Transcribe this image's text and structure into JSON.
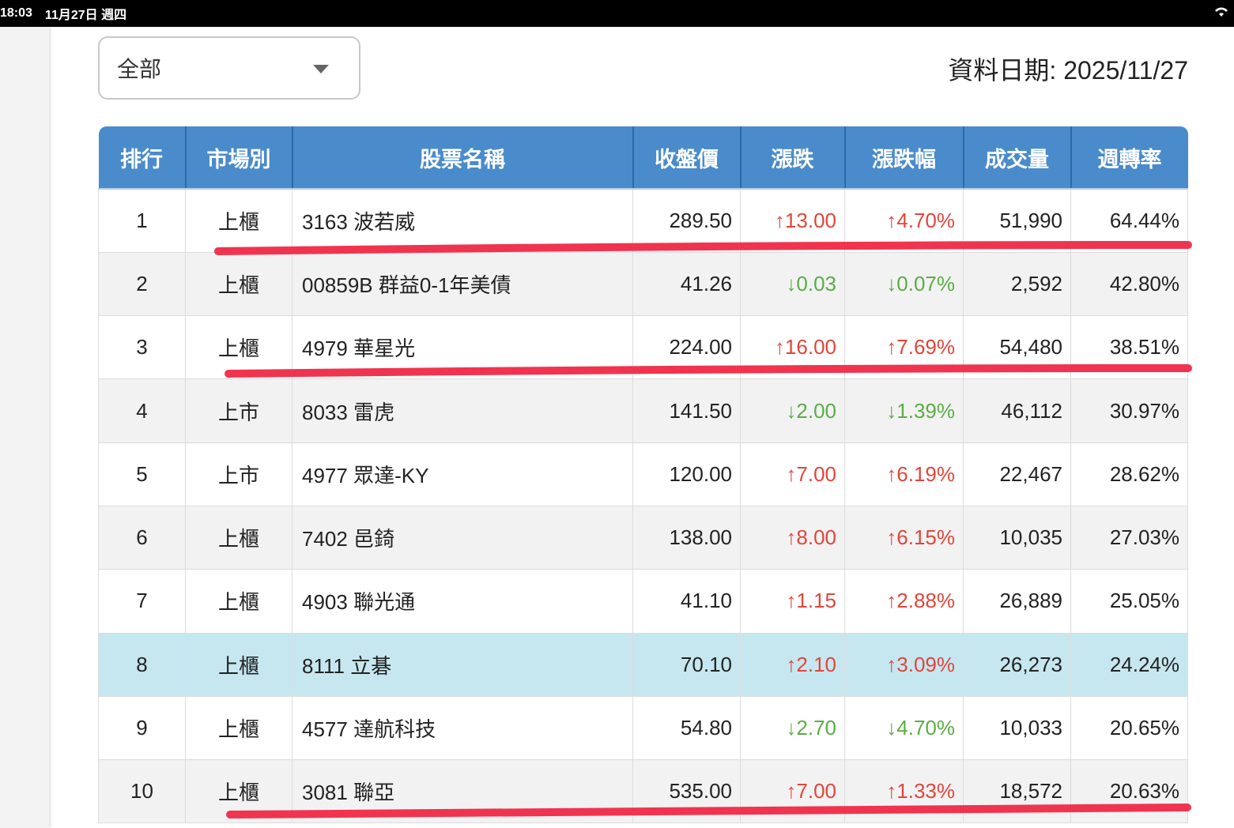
{
  "status_bar": {
    "time": "18:03",
    "date": "11月27日 週四"
  },
  "filter": {
    "selected": "全部"
  },
  "data_date": "資料日期: 2025/11/27",
  "columns": [
    "排行",
    "市場別",
    "股票名稱",
    "收盤價",
    "漲跌",
    "漲跌幅",
    "成交量",
    "週轉率"
  ],
  "rows": [
    {
      "rank": "1",
      "market": "上櫃",
      "name": "3163 波若威",
      "close": "289.50",
      "change": "↑13.00",
      "pct": "↑4.70%",
      "volume": "51,990",
      "turnover": "64.44%",
      "dir": "up"
    },
    {
      "rank": "2",
      "market": "上櫃",
      "name": "00859B 群益0-1年美債",
      "close": "41.26",
      "change": "↓0.03",
      "pct": "↓0.07%",
      "volume": "2,592",
      "turnover": "42.80%",
      "dir": "down"
    },
    {
      "rank": "3",
      "market": "上櫃",
      "name": "4979 華星光",
      "close": "224.00",
      "change": "↑16.00",
      "pct": "↑7.69%",
      "volume": "54,480",
      "turnover": "38.51%",
      "dir": "up"
    },
    {
      "rank": "4",
      "market": "上市",
      "name": "8033 雷虎",
      "close": "141.50",
      "change": "↓2.00",
      "pct": "↓1.39%",
      "volume": "46,112",
      "turnover": "30.97%",
      "dir": "down"
    },
    {
      "rank": "5",
      "market": "上市",
      "name": "4977 眾達-KY",
      "close": "120.00",
      "change": "↑7.00",
      "pct": "↑6.19%",
      "volume": "22,467",
      "turnover": "28.62%",
      "dir": "up"
    },
    {
      "rank": "6",
      "market": "上櫃",
      "name": "7402 邑錡",
      "close": "138.00",
      "change": "↑8.00",
      "pct": "↑6.15%",
      "volume": "10,035",
      "turnover": "27.03%",
      "dir": "up"
    },
    {
      "rank": "7",
      "market": "上櫃",
      "name": "4903 聯光通",
      "close": "41.10",
      "change": "↑1.15",
      "pct": "↑2.88%",
      "volume": "26,889",
      "turnover": "25.05%",
      "dir": "up"
    },
    {
      "rank": "8",
      "market": "上櫃",
      "name": "8111 立碁",
      "close": "70.10",
      "change": "↑2.10",
      "pct": "↑3.09%",
      "volume": "26,273",
      "turnover": "24.24%",
      "dir": "up"
    },
    {
      "rank": "9",
      "market": "上櫃",
      "name": "4577 達航科技",
      "close": "54.80",
      "change": "↓2.70",
      "pct": "↓4.70%",
      "volume": "10,033",
      "turnover": "20.65%",
      "dir": "down"
    },
    {
      "rank": "10",
      "market": "上櫃",
      "name": "3081 聯亞",
      "close": "535.00",
      "change": "↑7.00",
      "pct": "↑1.33%",
      "volume": "18,572",
      "turnover": "20.63%",
      "dir": "up"
    }
  ],
  "colors": {
    "header": "#4a8bcb",
    "up": "#e0463a",
    "down": "#5aad45",
    "highlight": "#c6e7f0",
    "annotation": "#f0344f"
  }
}
